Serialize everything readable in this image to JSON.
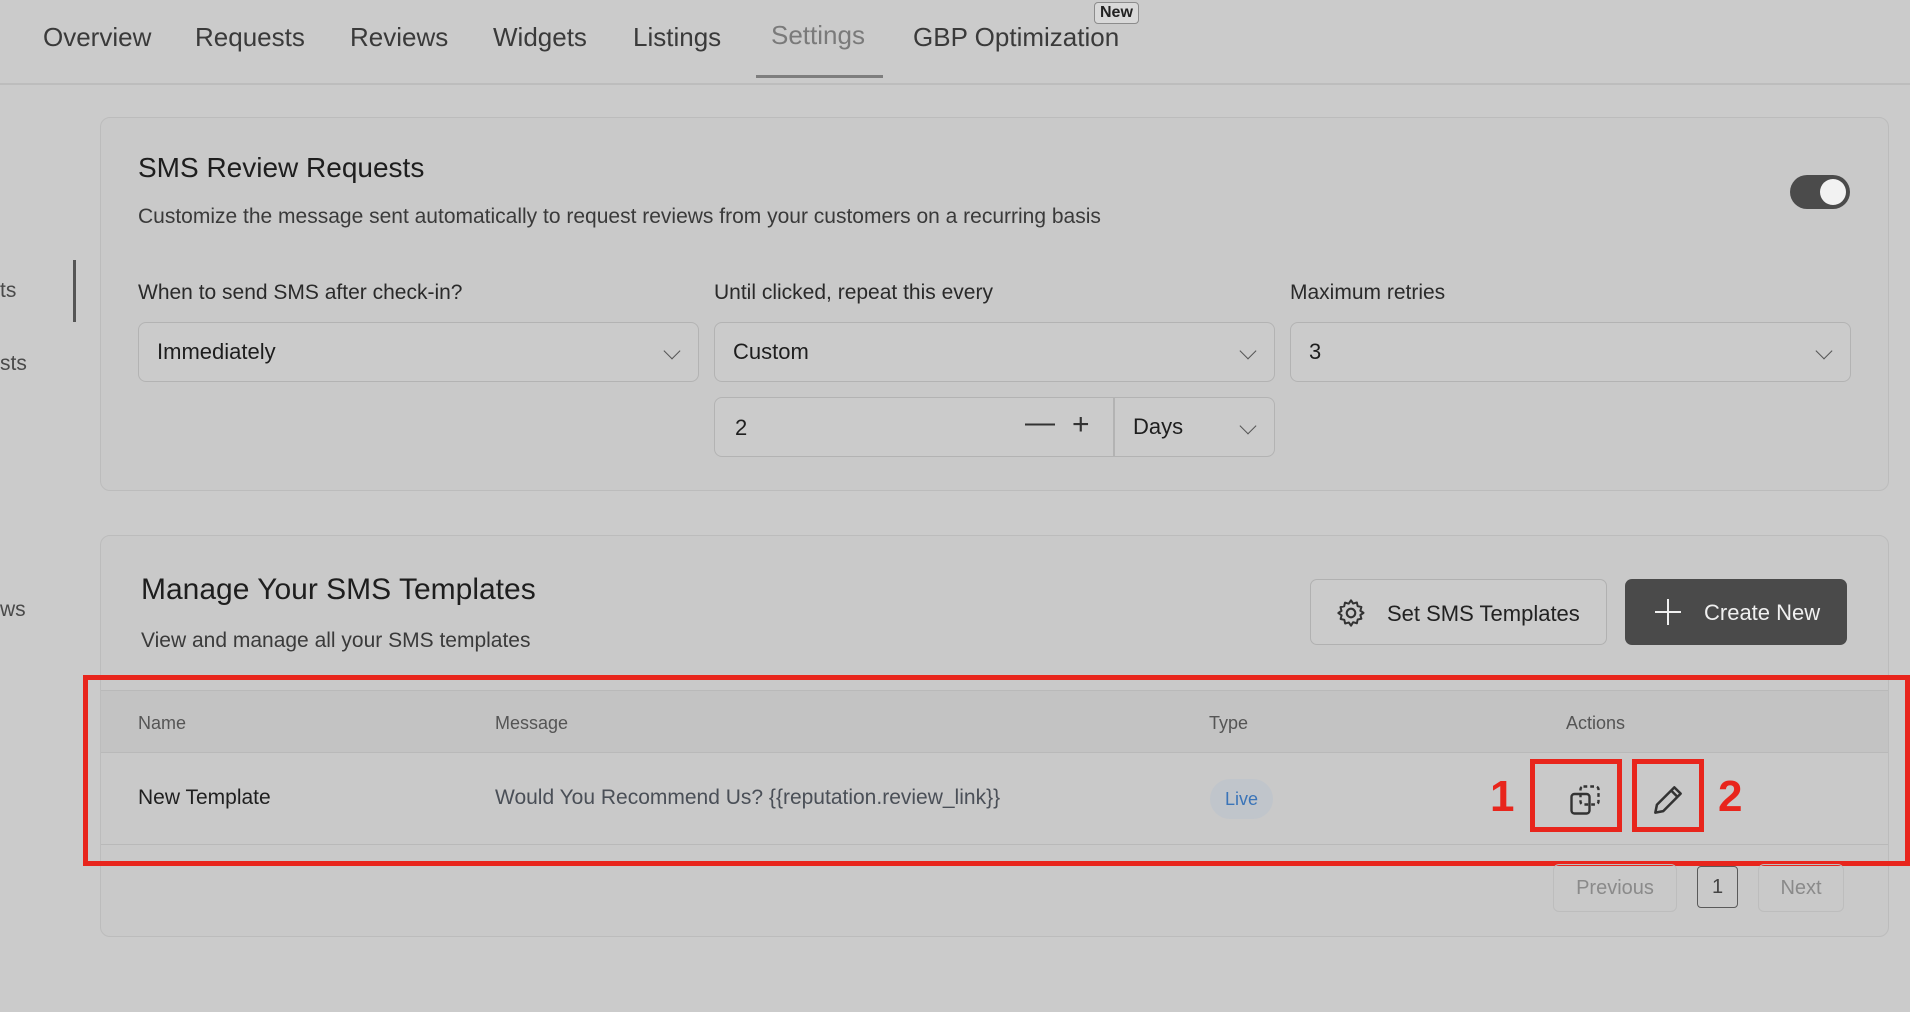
{
  "nav": {
    "tabs": [
      {
        "label": "Overview"
      },
      {
        "label": "Requests"
      },
      {
        "label": "Reviews"
      },
      {
        "label": "Widgets"
      },
      {
        "label": "Listings"
      },
      {
        "label": "Settings"
      },
      {
        "label": "GBP Optimization"
      }
    ],
    "active_tab": "Settings",
    "new_badge": "New"
  },
  "sidebar": {
    "fragments": [
      "ts",
      "sts",
      "ws"
    ]
  },
  "sms_requests": {
    "title": "SMS Review Requests",
    "description": "Customize the message sent automatically to request reviews from your customers on a recurring basis",
    "enabled": true,
    "when_label": "When to send SMS after check-in?",
    "when_value": "Immediately",
    "repeat_label": "Until clicked, repeat this every",
    "repeat_value": "Custom",
    "retries_label": "Maximum retries",
    "retries_value": "3",
    "interval_value": "2",
    "interval_unit": "Days",
    "minus": "—",
    "plus": "+"
  },
  "templates": {
    "title": "Manage Your SMS Templates",
    "subtitle": "View and manage all your SMS templates",
    "set_button": "Set SMS Templates",
    "create_button": "Create New",
    "columns": {
      "name": "Name",
      "message": "Message",
      "type": "Type",
      "actions": "Actions"
    },
    "rows": [
      {
        "name": "New Template",
        "message": "Would You Recommend Us? {{reputation.review_link}}",
        "type": "Live"
      }
    ],
    "annotations": [
      "1",
      "2"
    ],
    "pagination": {
      "previous": "Previous",
      "current": "1",
      "next": "Next"
    }
  },
  "colors": {
    "highlight": "#e8251c",
    "accent_dark": "#4a4a4a",
    "live_badge": "#3a74b8"
  }
}
